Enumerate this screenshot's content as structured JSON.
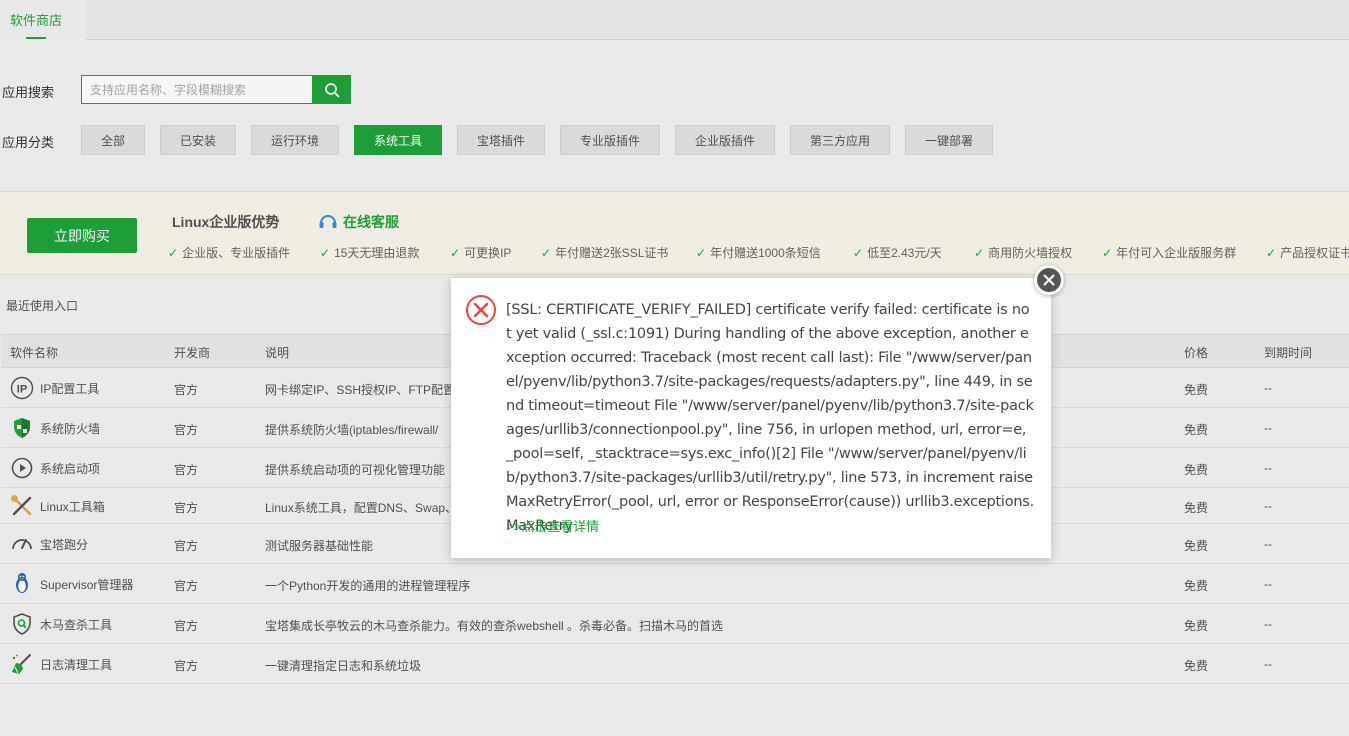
{
  "tab": {
    "label": "软件商店"
  },
  "search": {
    "label": "应用搜索",
    "placeholder": "支持应用名称、字段模糊搜索"
  },
  "categories": {
    "label": "应用分类",
    "items": [
      "全部",
      "已安装",
      "运行环境",
      "系统工具",
      "宝塔插件",
      "专业版插件",
      "企业版插件",
      "第三方应用",
      "一键部署"
    ],
    "active": "系统工具"
  },
  "promo": {
    "buy_label": "立即购买",
    "title": "Linux企业版优势",
    "service": "在线客服",
    "features": [
      "企业版、专业版插件",
      "15天无理由退款",
      "可更换IP",
      "年付赠送2张SSL证书",
      "年付赠送1000条短信",
      "低至2.43元/天",
      "商用防火墙授权",
      "年付可入企业版服务群",
      "产品授权证书"
    ]
  },
  "recent_label": "最近使用入口",
  "table": {
    "headers": [
      "软件名称",
      "开发商",
      "说明",
      "价格",
      "到期时间"
    ],
    "rows": [
      {
        "name": "IP配置工具",
        "dev": "官方",
        "desc": "网卡绑定IP、SSH授权IP、FTP配置",
        "price": "免费",
        "expire": "--",
        "icon": "ip-icon"
      },
      {
        "name": "系统防火墙",
        "dev": "官方",
        "desc": "提供系统防火墙(iptables/firewall/",
        "price": "免费",
        "expire": "--",
        "icon": "shield-icon"
      },
      {
        "name": "系统启动项",
        "dev": "官方",
        "desc": "提供系统启动项的可视化管理功能",
        "price": "免费",
        "expire": "--",
        "icon": "play-icon"
      },
      {
        "name": "Linux工具箱",
        "dev": "官方",
        "desc": "Linux系统工具，配置DNS、Swap、",
        "price": "免费",
        "expire": "--",
        "icon": "tools-icon"
      },
      {
        "name": "宝塔跑分",
        "dev": "官方",
        "desc": "测试服务器基础性能",
        "price": "免费",
        "expire": "--",
        "icon": "gauge-icon"
      },
      {
        "name": "Supervisor管理器",
        "dev": "官方",
        "desc": "一个Python开发的通用的进程管理程序",
        "price": "免费",
        "expire": "--",
        "icon": "penguin-icon"
      },
      {
        "name": "木马查杀工具",
        "dev": "官方",
        "desc": "宝塔集成长亭牧云的木马查杀能力。有效的查杀webshell 。杀毒必备。扫描木马的首选",
        "price": "免费",
        "expire": "--",
        "icon": "scan-shield-icon"
      },
      {
        "name": "日志清理工具",
        "dev": "官方",
        "desc": "一键清理指定日志和系统垃圾",
        "price": "免费",
        "expire": "--",
        "icon": "broom-icon"
      }
    ]
  },
  "modal": {
    "message": "[SSL: CERTIFICATE_VERIFY_FAILED] certificate verify failed: certificate is not yet valid (_ssl.c:1091) During handling of the above exception, another exception occurred: Traceback (most recent call last): File \"/www/server/panel/pyenv/lib/python3.7/site-packages/requests/adapters.py\", line 449, in send timeout=timeout File \"/www/server/panel/pyenv/lib/python3.7/site-packages/urllib3/connectionpool.py\", line 756, in urlopen method, url, error=e, _pool=self, _stacktrace=sys.exc_info()[2] File \"/www/server/panel/pyenv/lib/python3.7/site-packages/urllib3/util/retry.py\", line 573, in increment raise MaxRetryError(_pool, url, error or ResponseError(cause)) urllib3.exceptions.MaxRetry",
    "link": ">>点击查看详情"
  },
  "colors": {
    "accent": "#20a53a",
    "error": "#e8463c"
  }
}
